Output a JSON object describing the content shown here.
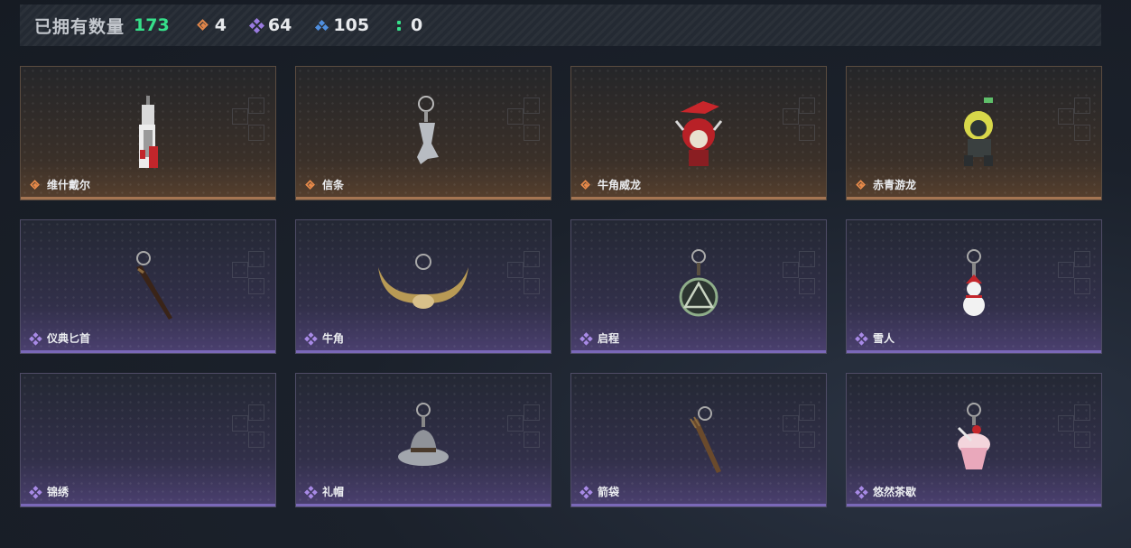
{
  "header": {
    "owned_label": "已拥有数量",
    "owned_count": "173",
    "stats": [
      {
        "icon": "orange-diamond-icon",
        "value": "4",
        "color": "#e0864a"
      },
      {
        "icon": "purple-quad-diamond-icon",
        "value": "64",
        "color": "#9a7be0"
      },
      {
        "icon": "blue-triple-diamond-icon",
        "value": "105",
        "color": "#4f8fe0"
      },
      {
        "icon": "green-dots-icon",
        "value": "0",
        "color": "#36e08a"
      }
    ]
  },
  "items": [
    {
      "name": "维什戴尔",
      "rarity": "orange",
      "icon": "tag-charm-icon"
    },
    {
      "name": "信条",
      "rarity": "orange",
      "icon": "metal-pendant-charm-icon"
    },
    {
      "name": "牛角威龙",
      "rarity": "orange",
      "icon": "red-creature-charm-icon"
    },
    {
      "name": "赤青游龙",
      "rarity": "orange",
      "icon": "dragon-figure-charm-icon"
    },
    {
      "name": "仪典匕首",
      "rarity": "purple",
      "icon": "dagger-charm-icon"
    },
    {
      "name": "牛角",
      "rarity": "purple",
      "icon": "horns-charm-icon"
    },
    {
      "name": "启程",
      "rarity": "purple",
      "icon": "triangle-medal-charm-icon"
    },
    {
      "name": "雪人",
      "rarity": "purple",
      "icon": "snowman-charm-icon"
    },
    {
      "name": "锦绣",
      "rarity": "purple",
      "icon": ""
    },
    {
      "name": "礼帽",
      "rarity": "purple",
      "icon": "hat-charm-icon"
    },
    {
      "name": "箭袋",
      "rarity": "purple",
      "icon": "quiver-charm-icon"
    },
    {
      "name": "悠然茶歇",
      "rarity": "purple",
      "icon": "cupcake-charm-icon"
    }
  ]
}
